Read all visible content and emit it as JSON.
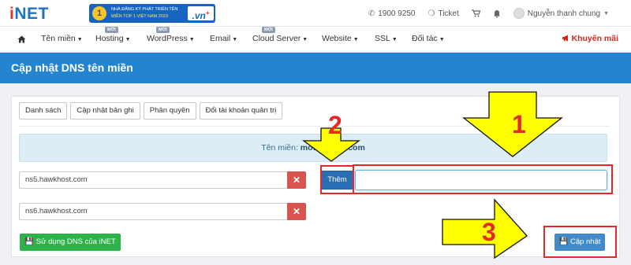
{
  "header": {
    "logo_prefix": "i",
    "logo_suffix": "NET",
    "promo_medal": "1",
    "promo_line1": "NHÀ ĐĂNG KÝ PHÁT TRIỂN TÊN",
    "promo_line2": "MIỀN TOP 1 VIỆT NAM 2023",
    "promo_vn": ".vn",
    "phone": "1900 9250",
    "ticket": "Ticket",
    "user_name": "Nguyễn thanh chung"
  },
  "nav": {
    "items": [
      {
        "label": "Tên miền"
      },
      {
        "label": "Hosting",
        "badge": "MỚI"
      },
      {
        "label": "WordPress",
        "badge": "MỚI"
      },
      {
        "label": "Email"
      },
      {
        "label": "Cloud Server",
        "badge": "MỚI"
      },
      {
        "label": "Website"
      },
      {
        "label": "SSL"
      },
      {
        "label": "Đối tác"
      }
    ],
    "promo": "Khuyến mãi"
  },
  "page_title": "Cập nhật DNS tên miền",
  "tabs": [
    "Danh sách",
    "Cập nhật bản ghi",
    "Phân quyền",
    "Đổi tài khoản quản trị"
  ],
  "domain_label": "Tên miền:",
  "domain_value": "motos",
  "domain_value_tail": ".com",
  "nameservers": [
    "ns5.hawkhost.com",
    "ns6.hawkhost.com"
  ],
  "add_button": "Thêm",
  "new_ns_value": "",
  "use_inet_dns_button": "Sử dụng DNS của iNET",
  "update_button": "Cập nhật",
  "annotations": [
    "1",
    "2",
    "3"
  ],
  "colors": {
    "brand_blue": "#2384cf",
    "danger": "#d9534f",
    "success": "#2db34a",
    "annotation_red": "#e32929",
    "arrow_yellow": "#ffff00"
  }
}
